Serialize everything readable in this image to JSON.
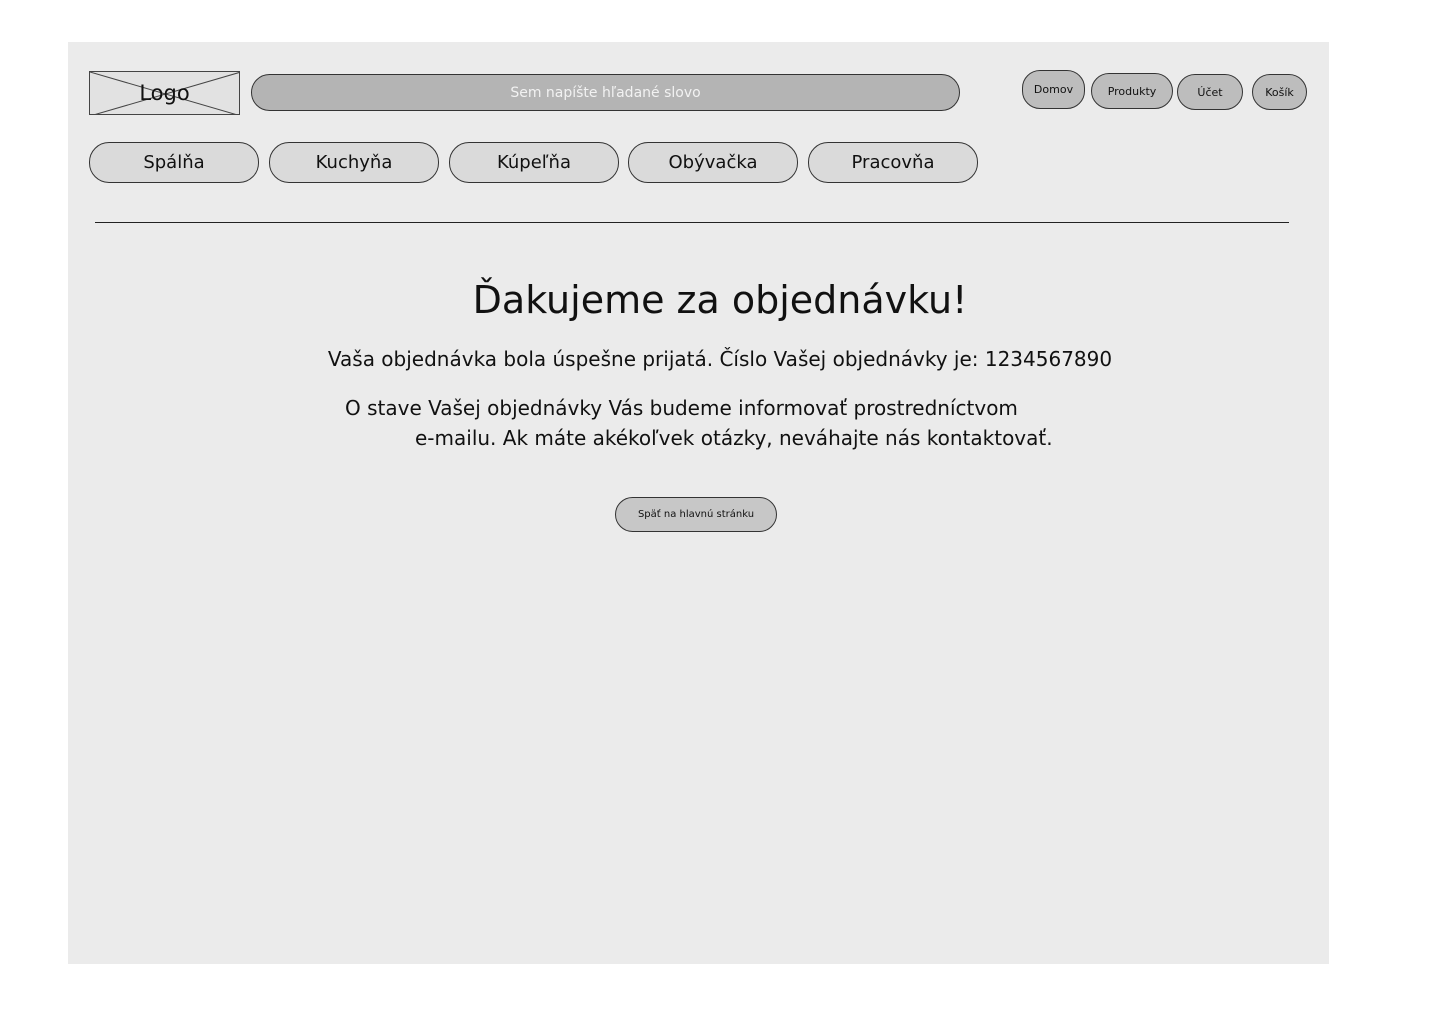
{
  "header": {
    "logo_text": "Logo",
    "search_placeholder": "Sem napíšte hľadané slovo",
    "nav": {
      "home": "Domov",
      "products": "Produkty",
      "account": "Účet",
      "cart": "Košík"
    }
  },
  "categories": [
    "Spálňa",
    "Kuchyňa",
    "Kúpeľňa",
    "Obývačka",
    "Pracovňa"
  ],
  "main": {
    "title": "Ďakujeme za objednávku!",
    "confirmation": "Vaša objednávka bola úspešne prijatá. Číslo Vašej objednávky je: 1234567890",
    "info_line1": "O stave Vašej objednávky Vás budeme informovať prostredníctvom",
    "info_line2": "e-mailu. Ak máte akékoľvek otázky, neváhajte nás kontaktovať.",
    "back_button": "Späť na hlavnú stránku"
  },
  "colors": {
    "canvas": "#ebebeb",
    "search_bg": "#b4b4b4",
    "button_bg": "#bdbdbd",
    "category_bg": "#dadada"
  }
}
